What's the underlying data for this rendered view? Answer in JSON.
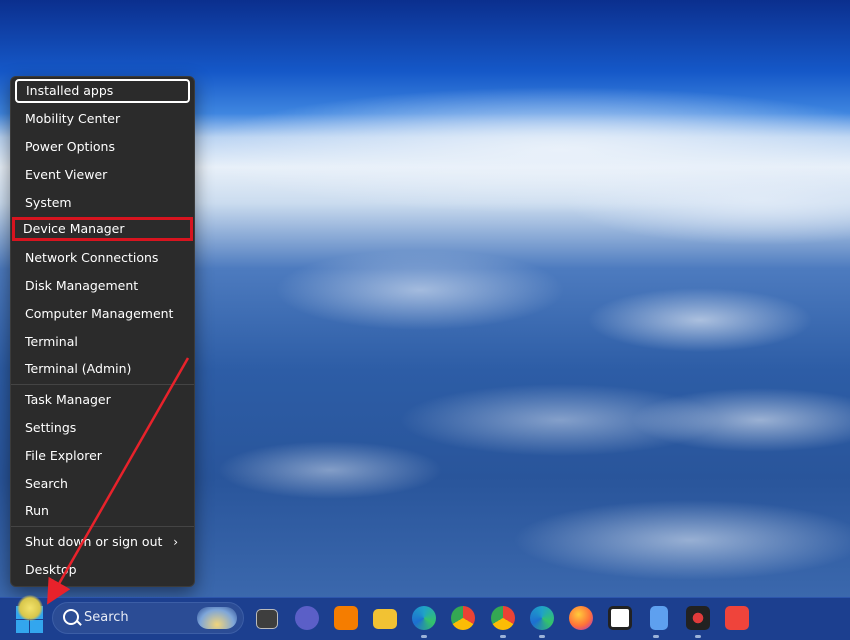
{
  "context_menu": {
    "items": [
      {
        "label": "Installed apps"
      },
      {
        "label": "Mobility Center"
      },
      {
        "label": "Power Options"
      },
      {
        "label": "Event Viewer"
      },
      {
        "label": "System"
      },
      {
        "label": "Device Manager"
      },
      {
        "label": "Network Connections"
      },
      {
        "label": "Disk Management"
      },
      {
        "label": "Computer Management"
      },
      {
        "label": "Terminal"
      },
      {
        "label": "Terminal (Admin)"
      },
      {
        "label": "Task Manager"
      },
      {
        "label": "Settings"
      },
      {
        "label": "File Explorer"
      },
      {
        "label": "Search"
      },
      {
        "label": "Run"
      },
      {
        "label": "Shut down or sign out"
      },
      {
        "label": "Desktop"
      }
    ],
    "highlight_color": "#d7141f"
  },
  "taskbar": {
    "search_label": "Search",
    "icons": [
      {
        "name": "task-view-icon",
        "color": "#d0d0d0"
      },
      {
        "name": "meet-icon",
        "color": "#5b5fc7"
      },
      {
        "name": "blogger-icon",
        "color": "#f57d00"
      },
      {
        "name": "file-explorer-icon",
        "color": "#f2c233"
      },
      {
        "name": "edge-icon",
        "color": "#1fa2c8"
      },
      {
        "name": "chrome-icon",
        "color": "#34a853"
      },
      {
        "name": "chrome-profile-icon",
        "color": "#34a853"
      },
      {
        "name": "edge-beta-icon",
        "color": "#1fa2c8"
      },
      {
        "name": "firefox-icon",
        "color": "#ff7139"
      },
      {
        "name": "m-app-icon",
        "color": "#ffffff"
      },
      {
        "name": "notepad-icon",
        "color": "#5ea0ef"
      },
      {
        "name": "recorder-icon",
        "color": "#e23b3b"
      },
      {
        "name": "anydesk-icon",
        "color": "#ef443b"
      }
    ]
  },
  "annotation": {
    "arrow_color": "#e8222b"
  }
}
